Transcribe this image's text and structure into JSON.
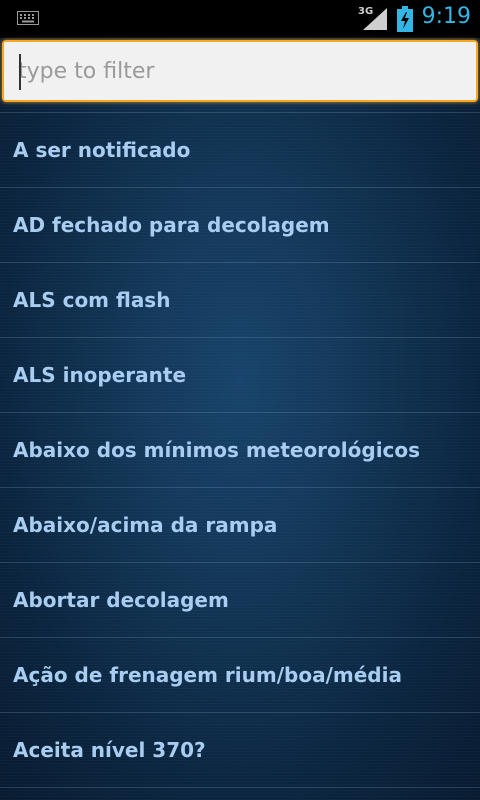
{
  "status_bar": {
    "network_label": "3G",
    "time": "9:19",
    "icons": [
      "keyboard-icon",
      "signal-icon",
      "battery-charging-icon"
    ],
    "accent_color": "#33b5e5"
  },
  "filter": {
    "placeholder": "type to filter",
    "value": "",
    "focus_color": "#f5a623"
  },
  "list": {
    "items": [
      {
        "label": "A ser notificado"
      },
      {
        "label": "AD fechado para decolagem"
      },
      {
        "label": "ALS com flash"
      },
      {
        "label": "ALS inoperante"
      },
      {
        "label": "Abaixo dos mínimos meteorológicos"
      },
      {
        "label": "Abaixo/acima da rampa"
      },
      {
        "label": "Abortar decolagem"
      },
      {
        "label": "Ação de frenagem rium/boa/média"
      },
      {
        "label": "Aceita nível 370?"
      }
    ],
    "text_color": "#a9cdf0"
  }
}
